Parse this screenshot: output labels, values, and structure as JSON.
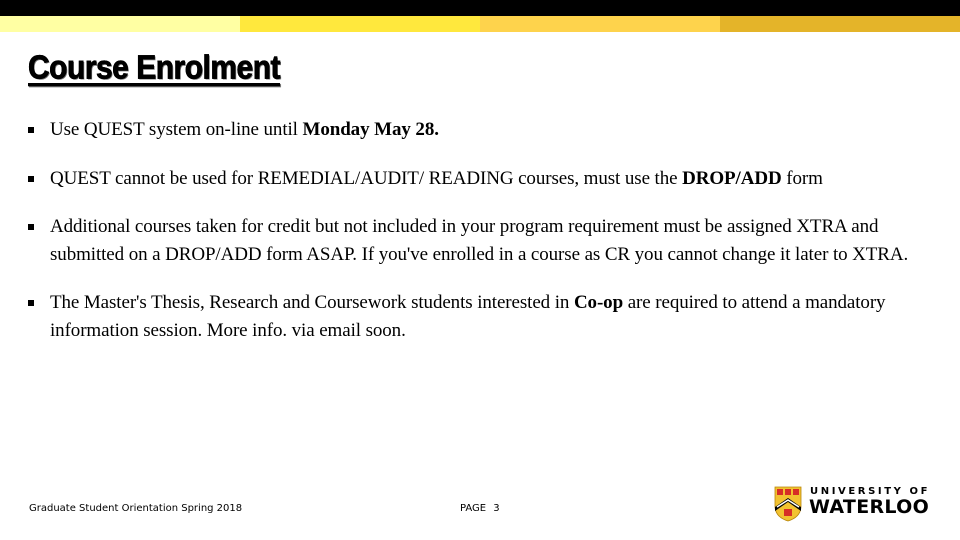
{
  "header": {
    "stripe_colors": [
      "#FFFFA3",
      "#FFE83D",
      "#FED34C",
      "#E4B429"
    ],
    "band_color": "#000000"
  },
  "slide": {
    "title": "Course Enrolment",
    "bullets": [
      {
        "parts": [
          {
            "text": "Use QUEST system on-line until ",
            "bold": false
          },
          {
            "text": "Monday May 28.",
            "bold": true
          }
        ]
      },
      {
        "parts": [
          {
            "text": "QUEST cannot be used for REMEDIAL/AUDIT/ READING courses, must use the ",
            "bold": false
          },
          {
            "text": "DROP/ADD",
            "bold": true
          },
          {
            "text": " form",
            "bold": false
          }
        ]
      },
      {
        "parts": [
          {
            "text": "Additional courses taken for credit but not included in your program requirement must be assigned XTRA and submitted on a DROP/ADD form ASAP. If you've enrolled in a course as CR you cannot change it later to XTRA.",
            "bold": false
          }
        ]
      },
      {
        "parts": [
          {
            "text": "The Master's Thesis, Research and Coursework students interested in ",
            "bold": false
          },
          {
            "text": "Co-op",
            "bold": true
          },
          {
            "text": " are required to attend a mandatory information session. More info. via email soon.",
            "bold": false
          }
        ]
      }
    ]
  },
  "footer": {
    "event": "Graduate Student Orientation Spring 2018",
    "page_label": "PAGE 3"
  },
  "logo": {
    "line1": "UNIVERSITY OF",
    "line2": "WATERLOO",
    "icon": "university-shield-icon"
  }
}
